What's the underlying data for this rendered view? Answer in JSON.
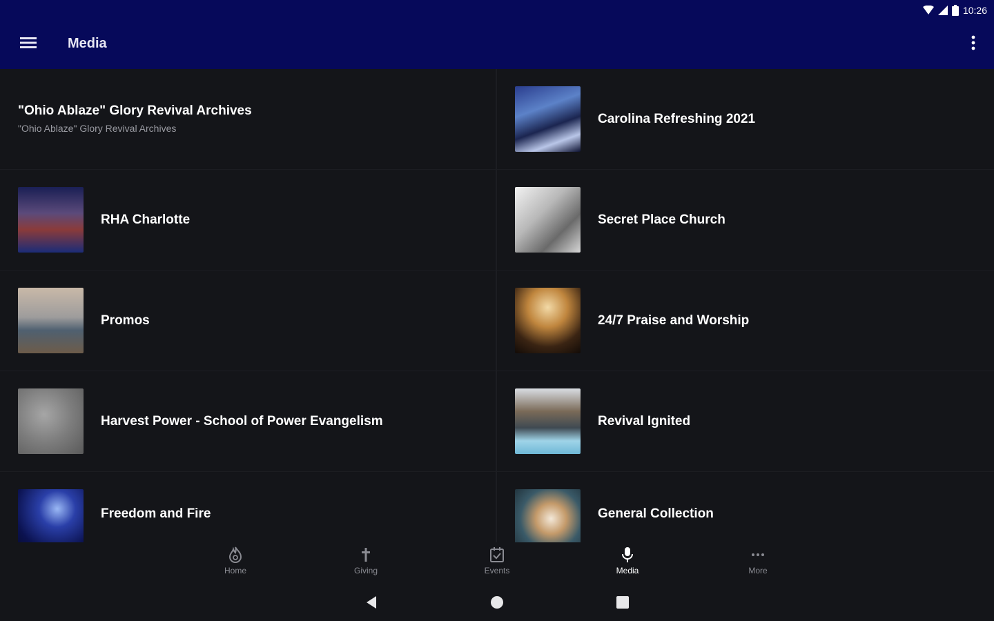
{
  "status": {
    "time": "10:26"
  },
  "app_bar": {
    "title": "Media"
  },
  "items": [
    {
      "title": "\"Ohio Ablaze\" Glory Revival Archives",
      "subtitle": "\"Ohio Ablaze\" Glory Revival Archives"
    },
    {
      "title": "Carolina Refreshing 2021"
    },
    {
      "title": "RHA Charlotte"
    },
    {
      "title": "Secret Place Church"
    },
    {
      "title": "Promos"
    },
    {
      "title": "24/7 Praise and Worship"
    },
    {
      "title": "Harvest Power - School of Power Evangelism"
    },
    {
      "title": "Revival Ignited"
    },
    {
      "title": "Freedom and Fire"
    },
    {
      "title": "General Collection"
    }
  ],
  "bottom_nav": [
    {
      "label": "Home",
      "icon": "flame-icon"
    },
    {
      "label": "Giving",
      "icon": "cross-icon"
    },
    {
      "label": "Events",
      "icon": "calendar-check-icon"
    },
    {
      "label": "Media",
      "icon": "microphone-icon"
    },
    {
      "label": "More",
      "icon": "more-horizontal-icon"
    }
  ],
  "colors": {
    "app_bar": "#06095a",
    "background": "#141519",
    "nav_inactive": "#8a8b92",
    "nav_active": "#ffffff"
  }
}
